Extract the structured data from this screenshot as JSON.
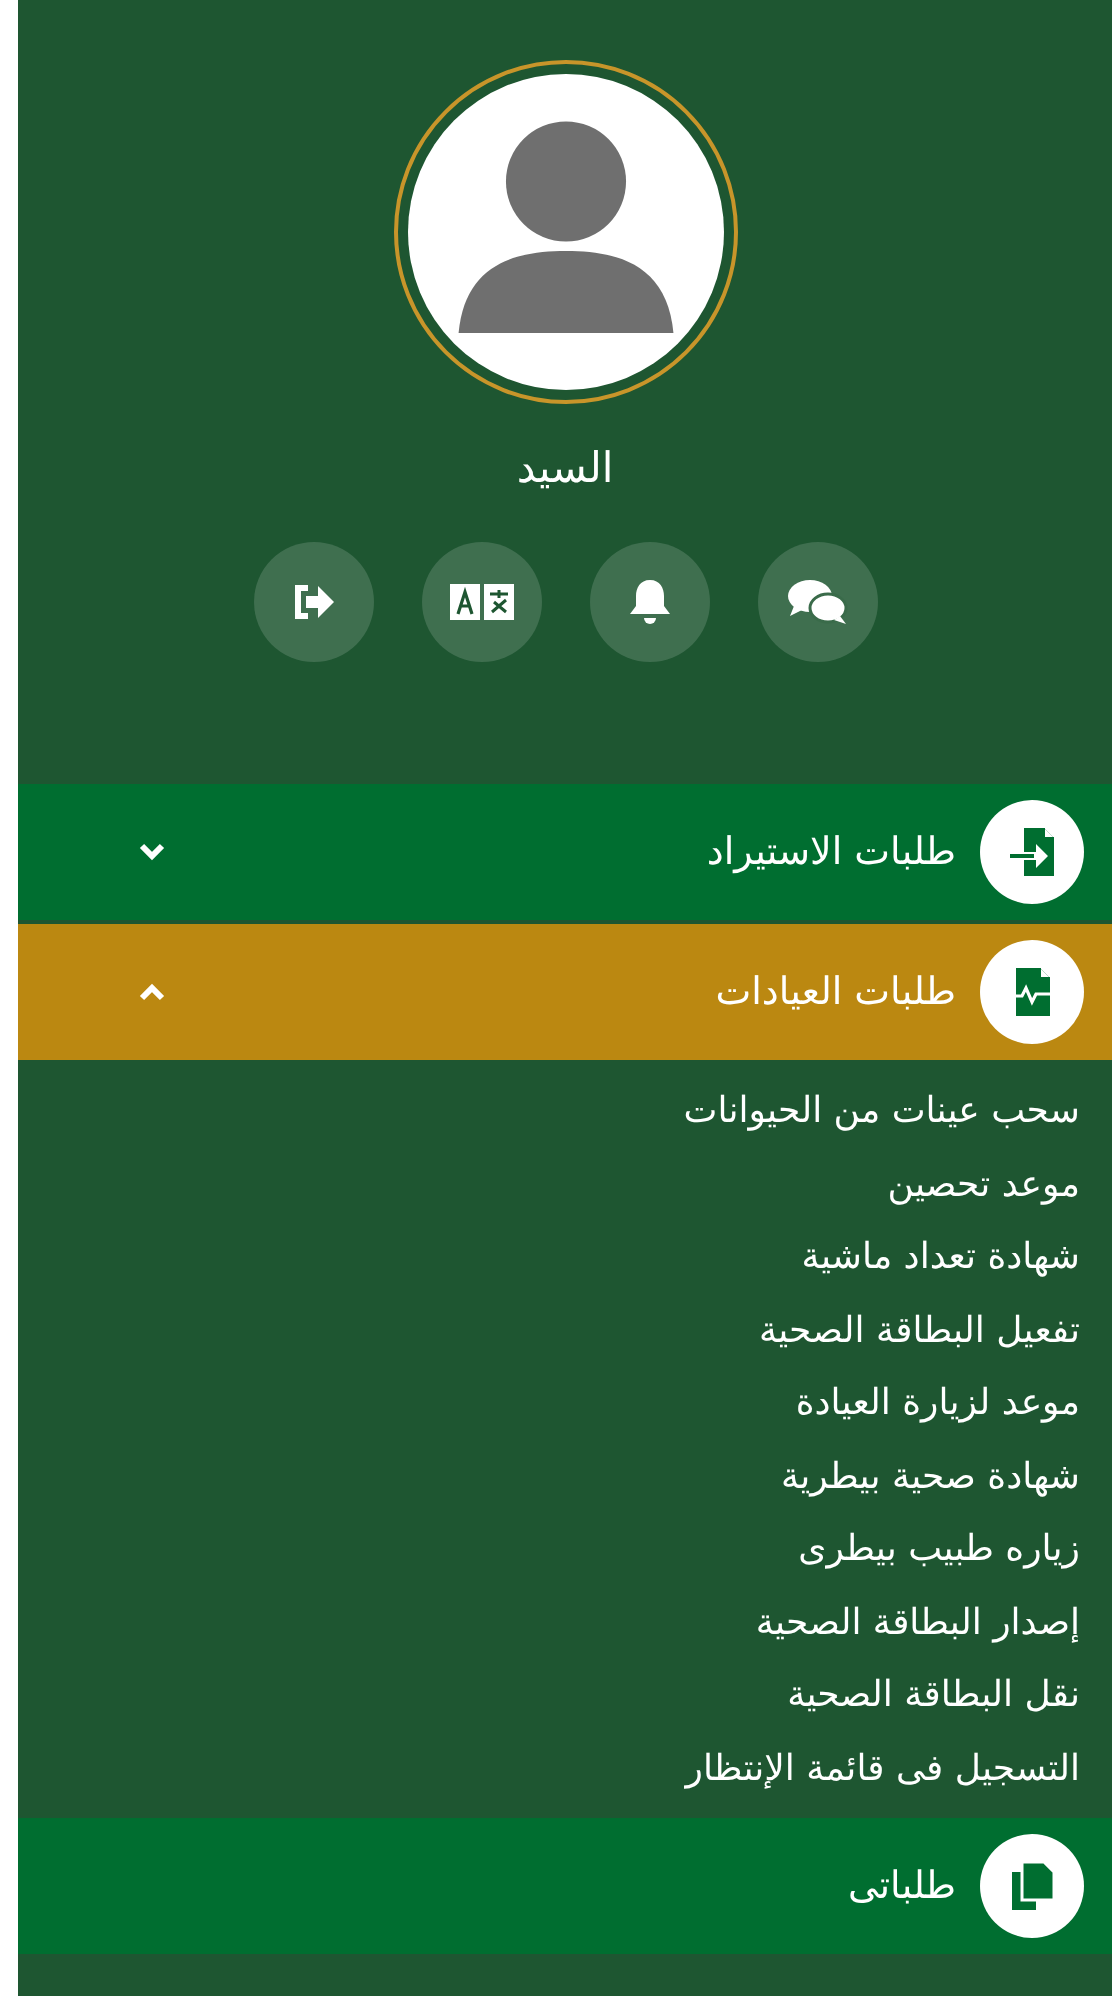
{
  "profile": {
    "name": "السيد"
  },
  "menu": [
    {
      "label": "طلبات الاستيراد",
      "kind": "group",
      "expanded": false,
      "selected": false
    },
    {
      "label": "طلبات العيادات",
      "kind": "group",
      "expanded": true,
      "selected": true,
      "children": [
        {
          "label": "سحب عينات من الحيوانات"
        },
        {
          "label": "موعد تحصين"
        },
        {
          "label": "شهادة تعداد ماشية"
        },
        {
          "label": "تفعيل البطاقة الصحية"
        },
        {
          "label": "موعد لزيارة العيادة"
        },
        {
          "label": "شهادة صحية بيطرية"
        },
        {
          "label": "زياره طبيب بيطرى"
        },
        {
          "label": "إصدار البطاقة الصحية"
        },
        {
          "label": "نقل البطاقة الصحية"
        },
        {
          "label": "التسجيل فى قائمة الإنتظار"
        }
      ]
    },
    {
      "label": "طلباتى",
      "kind": "link",
      "selected": false
    }
  ]
}
